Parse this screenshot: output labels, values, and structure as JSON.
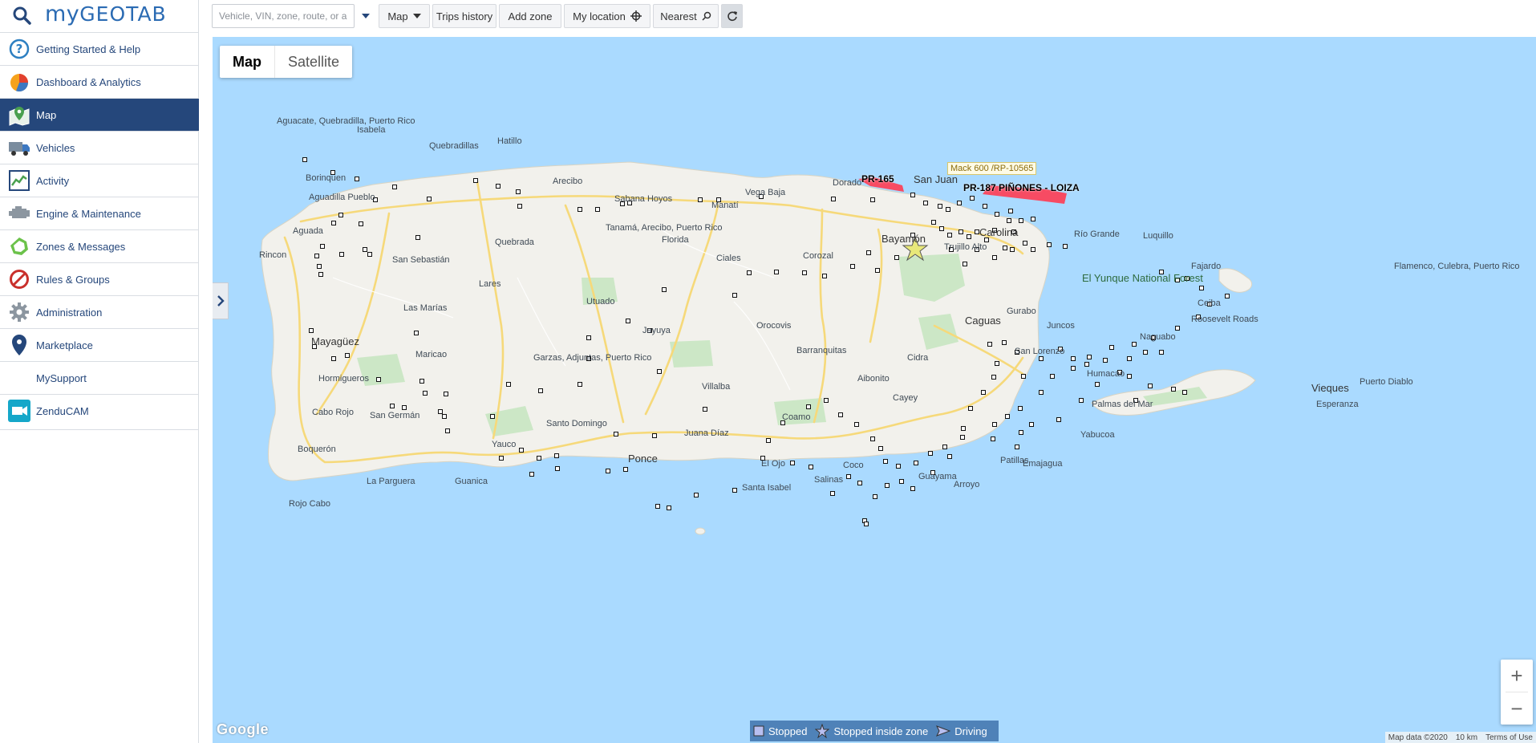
{
  "brand": {
    "logo_prefix": "my",
    "logo_main": "GEOTAB"
  },
  "nav": {
    "items": [
      {
        "label": "Getting Started & Help",
        "icon": "help-circle-icon"
      },
      {
        "label": "Dashboard & Analytics",
        "icon": "pie-chart-icon"
      },
      {
        "label": "Map",
        "icon": "map-pin-icon",
        "active": true
      },
      {
        "label": "Vehicles",
        "icon": "truck-icon"
      },
      {
        "label": "Activity",
        "icon": "line-graph-icon"
      },
      {
        "label": "Engine & Maintenance",
        "icon": "engine-icon"
      },
      {
        "label": "Zones & Messages",
        "icon": "zone-icon"
      },
      {
        "label": "Rules & Groups",
        "icon": "prohibited-icon"
      },
      {
        "label": "Administration",
        "icon": "gear-icon"
      },
      {
        "label": "Marketplace",
        "icon": "marketplace-pin-icon"
      },
      {
        "label": "MySupport",
        "icon": ""
      },
      {
        "label": "ZenduCAM",
        "icon": "camera-app-icon"
      }
    ]
  },
  "toolbar": {
    "search_placeholder": "Vehicle, VIN, zone, route, or a",
    "map_label": "Map",
    "trips_label": "Trips history",
    "add_zone_label": "Add zone",
    "my_location_label": "My location",
    "nearest_label": "Nearest"
  },
  "map": {
    "type_map": "Map",
    "type_satellite": "Satellite",
    "google": "Google",
    "attribution_data": "Map data ©2020",
    "attribution_scale": "10 km",
    "attribution_terms": "Terms of Use",
    "zones": [
      "PR-165",
      "PR-187 PIÑONES - LOIZA"
    ],
    "vehicle_tooltip": "Mack 600 /RP-10565",
    "places": [
      "Aguacate, Quebradilla, Puerto Rico",
      "Isabela",
      "Quebradillas",
      "Hatillo",
      "Arecibo",
      "Borinquen",
      "Aguadilla Pueblo",
      "Aguada",
      "Rincon",
      "San Sebastián",
      "Lares",
      "Las Marías",
      "Mayagüez",
      "Maricao",
      "Hormigueros",
      "Cabo Rojo",
      "San Germán",
      "Boquerón",
      "La Parguera",
      "Guanica",
      "Rojo Cabo",
      "Yauco",
      "Ponce",
      "Juana Díaz",
      "Santa Isabel",
      "Santo Domingo",
      "Gurabo",
      "Tanamá, Arecibo, Puerto Rico",
      "Quebrada",
      "Utuado",
      "Jayuya",
      "Florida",
      "Ciales",
      "Barranquitas",
      "Orocovis",
      "Corozal",
      "Manatí",
      "Vega Baja",
      "Dorado",
      "Sabana Hoyos",
      "San Juan",
      "Bayamón",
      "Carolina",
      "Trujillo Alto",
      "Río Grande",
      "Luquillo",
      "Fajardo",
      "Ceiba",
      "Roosevelt Roads",
      "Naguabo",
      "Humacao",
      "Palmas del Mar",
      "Yabucoa",
      "Patillas",
      "Arroyo",
      "Guayama",
      "Salinas",
      "Coco",
      "El Ojo",
      "Cayey",
      "Aibonito",
      "Cidra",
      "Caguas",
      "Juncos",
      "San Lorenzo",
      "Villalba",
      "Coamo",
      "Gurabo",
      "Emajagua",
      "Vieques",
      "Esperanza",
      "Puerto Diablo",
      "Flamenco, Culebra, Puerto Rico",
      "El Yunque National Forest",
      "Garzas, Adjuntas, Puerto Rico"
    ],
    "legend": {
      "stopped": "Stopped",
      "stopped_zone": "Stopped inside zone",
      "driving": "Driving"
    }
  },
  "colors": {
    "nav_active": "#25477b",
    "water": "#aadaff",
    "land": "#f2f1ec",
    "zone": "#ff3b52",
    "legend_bg": "#4f82b8"
  }
}
